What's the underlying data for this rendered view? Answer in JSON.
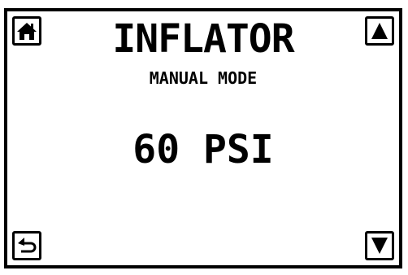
{
  "screen": {
    "title": "INFLATOR",
    "mode": "MANUAL MODE",
    "pressure_display": "60 PSI"
  },
  "buttons": {
    "home": {
      "icon": "home-icon"
    },
    "increase": {
      "icon": "up-triangle-icon"
    },
    "back": {
      "icon": "return-arrow-icon"
    },
    "decrease": {
      "icon": "down-triangle-icon"
    }
  }
}
